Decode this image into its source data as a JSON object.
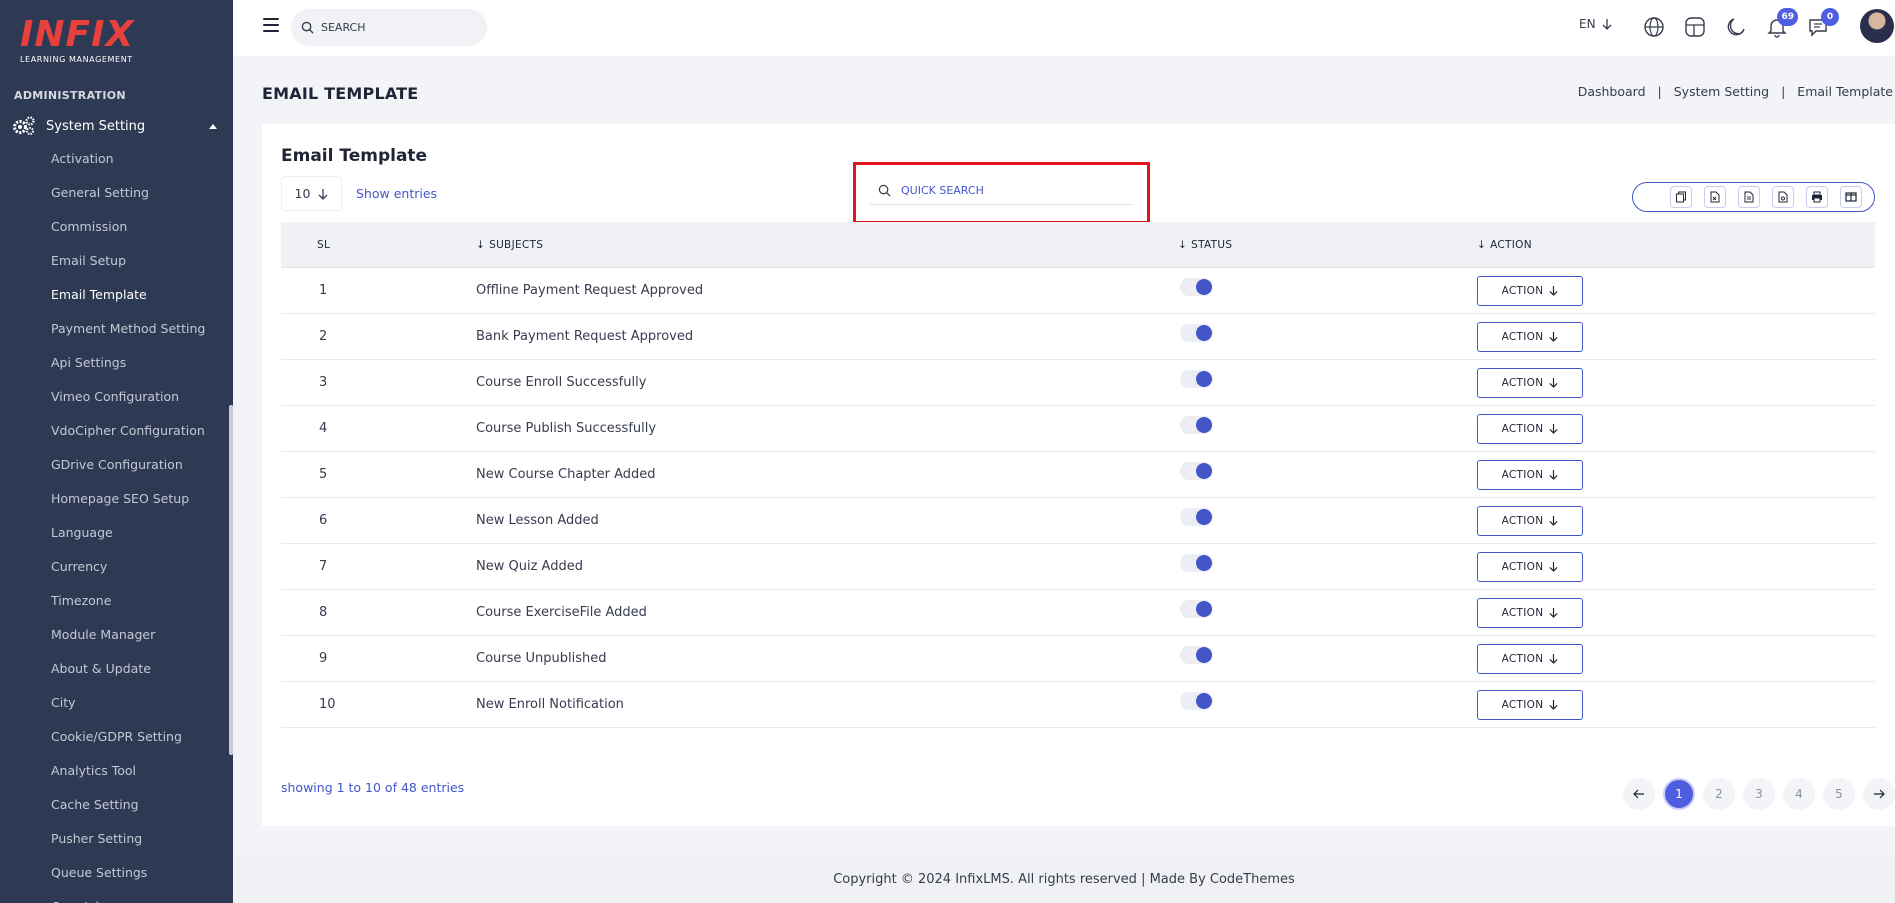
{
  "brand": {
    "logo_text": "INFIX",
    "logo_sub": "LEARNING MANAGEMENT"
  },
  "sidebar": {
    "section_label": "ADMINISTRATION",
    "group_label": "System Setting",
    "items": [
      {
        "label": "Activation"
      },
      {
        "label": "General Setting"
      },
      {
        "label": "Commission"
      },
      {
        "label": "Email Setup"
      },
      {
        "label": "Email Template",
        "active": true
      },
      {
        "label": "Payment Method Setting"
      },
      {
        "label": "Api Settings"
      },
      {
        "label": "Vimeo Configuration"
      },
      {
        "label": "VdoCipher Configuration"
      },
      {
        "label": "GDrive Configuration"
      },
      {
        "label": "Homepage SEO Setup"
      },
      {
        "label": "Language"
      },
      {
        "label": "Currency"
      },
      {
        "label": "Timezone"
      },
      {
        "label": "Module Manager"
      },
      {
        "label": "About & Update"
      },
      {
        "label": "City"
      },
      {
        "label": "Cookie/GDPR Setting"
      },
      {
        "label": "Analytics Tool"
      },
      {
        "label": "Cache Setting"
      },
      {
        "label": "Pusher Setting"
      },
      {
        "label": "Queue Settings"
      },
      {
        "label": "Cron Job"
      }
    ]
  },
  "topbar": {
    "search_placeholder": "SEARCH",
    "language": "EN",
    "notifications_count": "69",
    "messages_count": "0"
  },
  "page": {
    "title": "EMAIL TEMPLATE",
    "breadcrumb": [
      "Dashboard",
      "System Setting",
      "Email Template"
    ]
  },
  "card": {
    "title": "Email Template",
    "entries_value": "10",
    "show_entries": "Show entries",
    "quick_search_placeholder": "QUICK SEARCH",
    "columns": {
      "sl": "SL",
      "subjects": "SUBJECTS",
      "status": "STATUS",
      "action": "ACTION"
    },
    "action_label": "ACTION",
    "rows": [
      {
        "sl": "1",
        "subject": "Offline Payment Request Approved",
        "status": true
      },
      {
        "sl": "2",
        "subject": "Bank Payment Request Approved",
        "status": true
      },
      {
        "sl": "3",
        "subject": "Course Enroll Successfully",
        "status": true
      },
      {
        "sl": "4",
        "subject": "Course Publish Successfully",
        "status": true
      },
      {
        "sl": "5",
        "subject": "New Course Chapter Added",
        "status": true
      },
      {
        "sl": "6",
        "subject": "New Lesson Added",
        "status": true
      },
      {
        "sl": "7",
        "subject": "New Quiz Added",
        "status": true
      },
      {
        "sl": "8",
        "subject": "Course ExerciseFile Added",
        "status": true
      },
      {
        "sl": "9",
        "subject": "Course Unpublished",
        "status": true
      },
      {
        "sl": "10",
        "subject": "New Enroll Notification",
        "status": true
      }
    ],
    "showing_text": "showing 1 to 10 of 48 entries",
    "pages": [
      "1",
      "2",
      "3",
      "4",
      "5"
    ],
    "current_page": "1"
  },
  "footer": {
    "text": "Copyright © 2024 InfixLMS. All rights reserved | Made By CodeThemes"
  },
  "colors": {
    "sidebar_bg": "#2e3a53",
    "accent": "#4356c9",
    "highlight_box": "#e2131b",
    "logo": "#e8403c"
  }
}
